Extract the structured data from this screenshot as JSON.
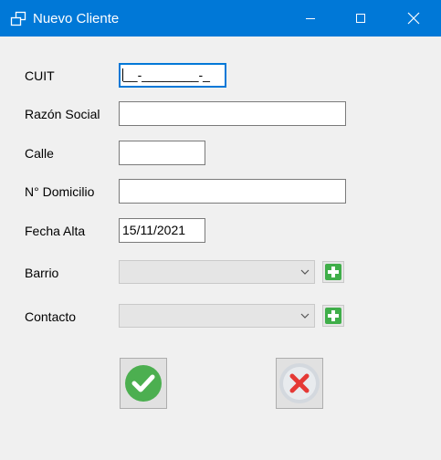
{
  "window": {
    "title": "Nuevo Cliente",
    "icon": "app-window-icon",
    "controls": [
      "minimize-icon",
      "maximize-icon",
      "close-icon"
    ]
  },
  "form": {
    "cuit": {
      "label": "CUIT",
      "value": "__-________-_"
    },
    "razon_social": {
      "label": "Razón Social",
      "value": ""
    },
    "calle": {
      "label": "Calle",
      "value": ""
    },
    "numero_domicilio": {
      "label": "N° Domicilio",
      "value": ""
    },
    "fecha_alta": {
      "label": "Fecha Alta",
      "value": "15/11/2021"
    },
    "barrio": {
      "label": "Barrio",
      "value": ""
    },
    "contacto": {
      "label": "Contacto",
      "value": ""
    }
  },
  "buttons": {
    "accept_icon": "check-circle-icon",
    "cancel_icon": "x-circle-icon",
    "add_icon": "plus-green-icon"
  },
  "colors": {
    "titlebar": "#0078d7",
    "accept": "#4caf50",
    "cancel": "#e53935",
    "add": "#3fae49"
  }
}
